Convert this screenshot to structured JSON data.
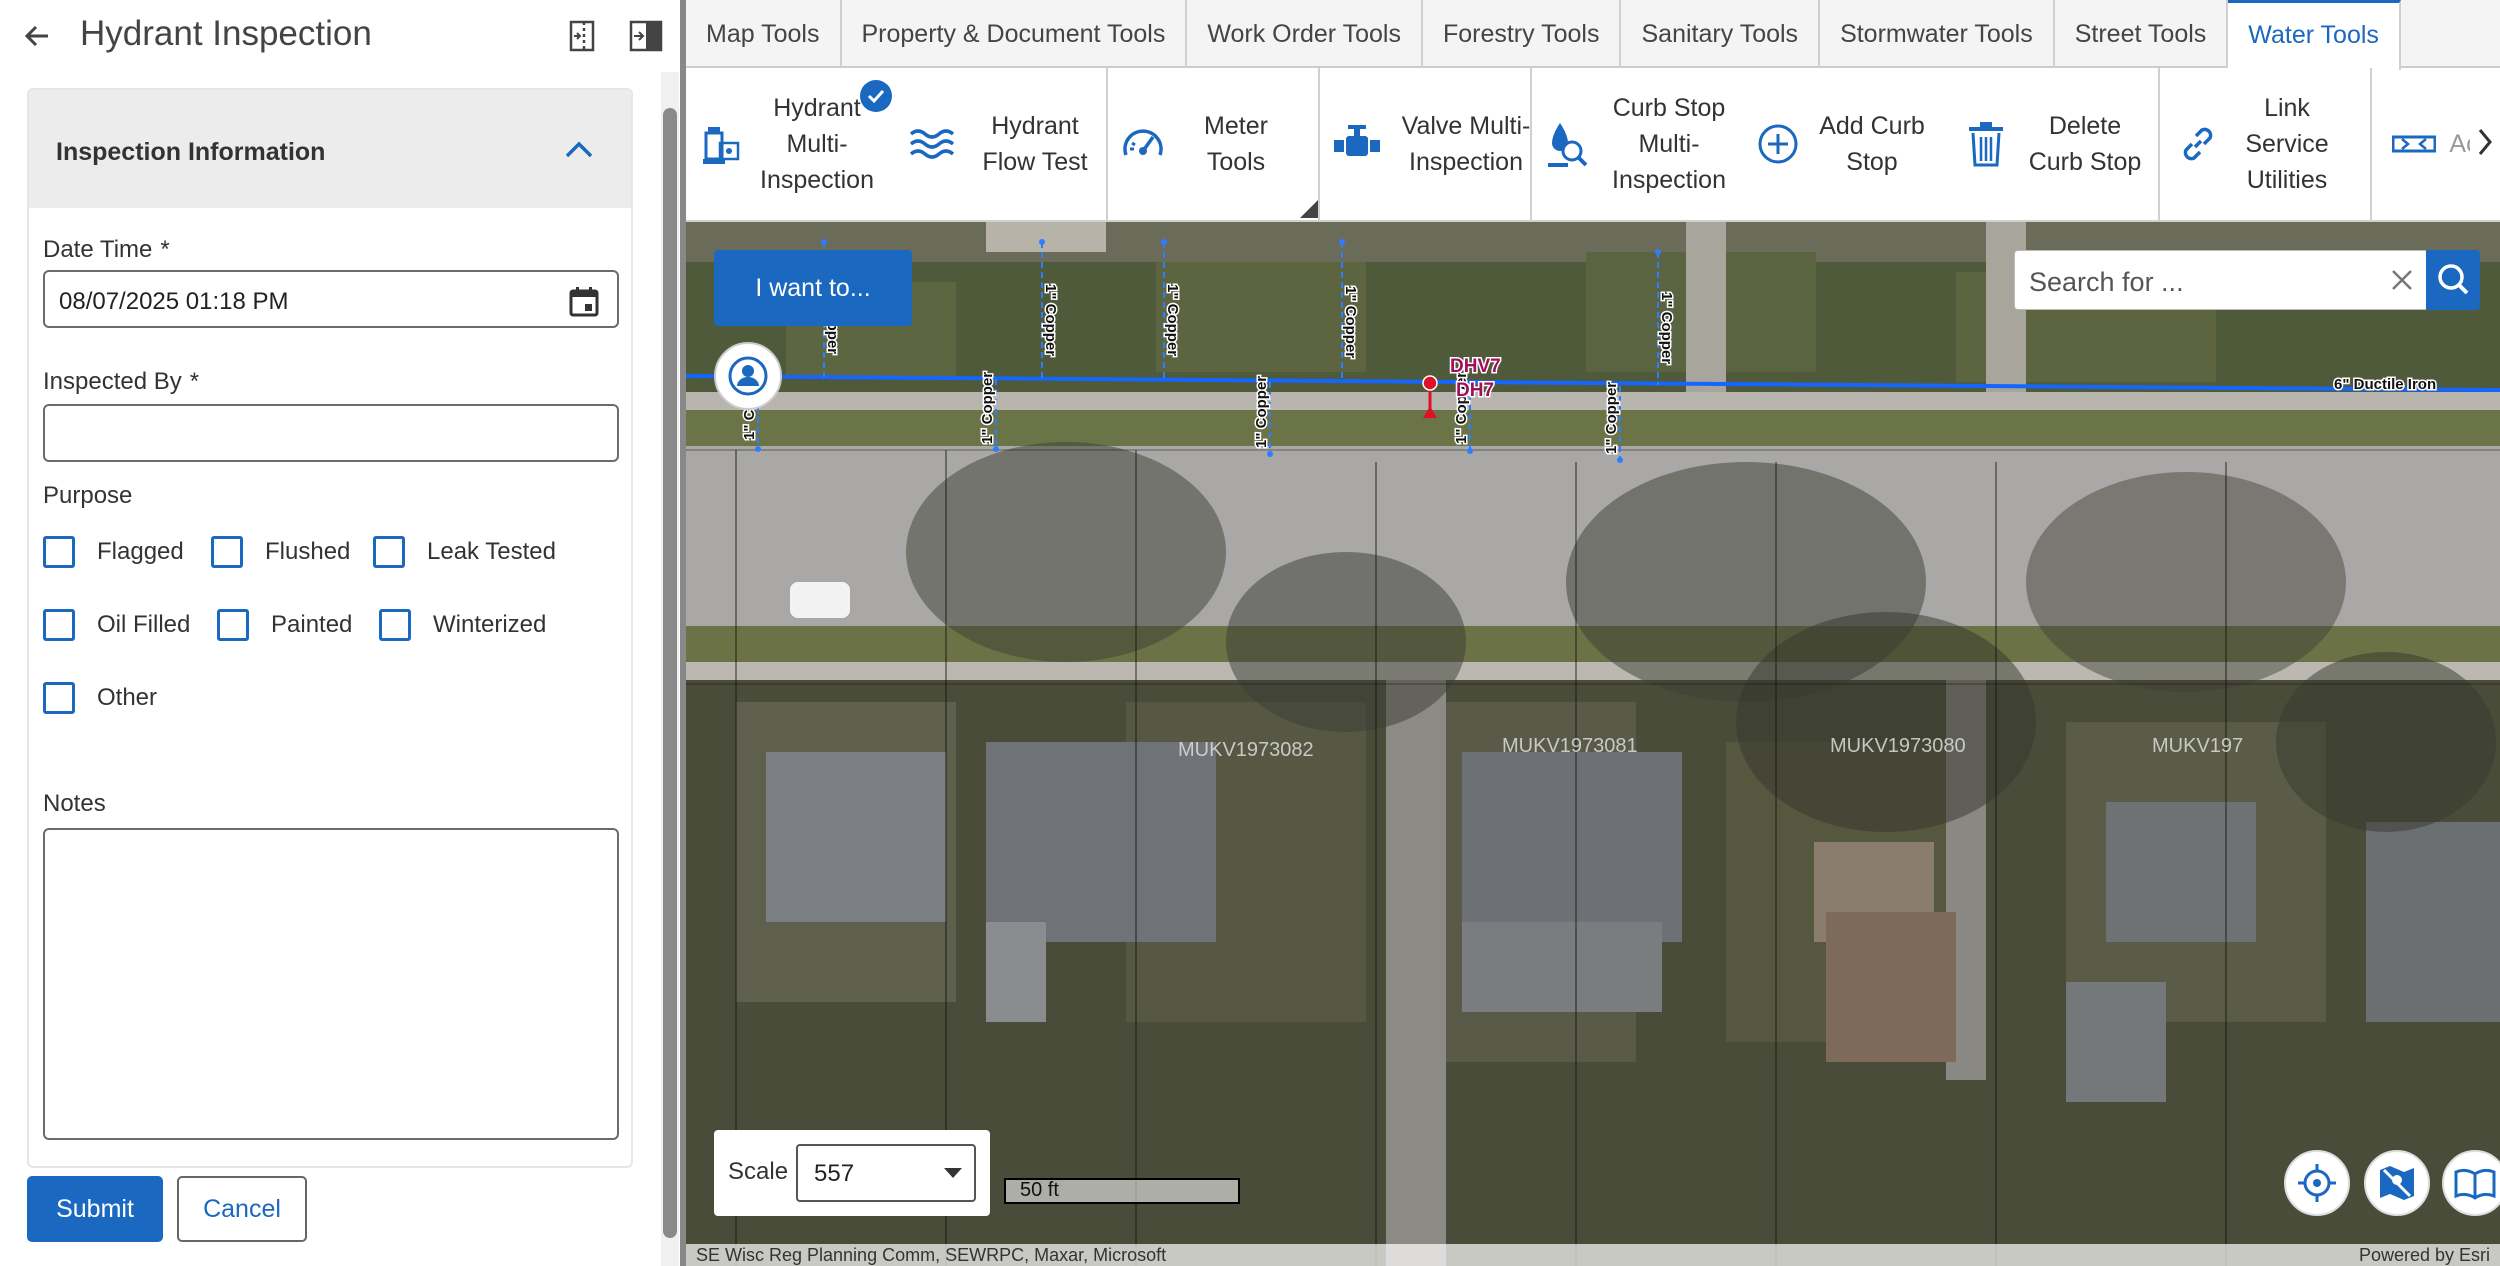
{
  "panel": {
    "title": "Hydrant Inspection",
    "section_title": "Inspection Information",
    "date_time_label": "Date Time",
    "date_time_value": "08/07/2025 01:18 PM",
    "inspected_by_label": "Inspected By",
    "inspected_by_value": "",
    "required_marker": "*",
    "purpose_label": "Purpose",
    "purpose_options": [
      "Flagged",
      "Flushed",
      "Leak Tested",
      "Oil Filled",
      "Painted",
      "Winterized",
      "Other"
    ],
    "notes_label": "Notes",
    "notes_value": "",
    "submit_label": "Submit",
    "cancel_label": "Cancel"
  },
  "tabs": [
    "Map Tools",
    "Property & Document Tools",
    "Work Order Tools",
    "Forestry Tools",
    "Sanitary Tools",
    "Stormwater Tools",
    "Street Tools",
    "Water Tools"
  ],
  "active_tab": "Water Tools",
  "ribbon": {
    "hydrant_multi": "Hydrant Multi-Inspection",
    "hydrant_flow": "Hydrant Flow Test",
    "meter_tools": "Meter Tools",
    "valve_multi": "Valve Multi-Inspection",
    "curb_stop_multi": "Curb Stop Multi-Inspection",
    "add_curb_stop": "Add Curb Stop",
    "delete_curb_stop": "Delete Curb Stop",
    "link_service": "Link Service Utilities",
    "partial_button": "Ac"
  },
  "map": {
    "i_want_to": "I want to...",
    "search_placeholder": "Search for ...",
    "scale_label": "Scale",
    "scale_value": "557",
    "scalebar_label": "50 ft",
    "service_label": "1\" Copper",
    "main_label": "6\" Ductile Iron",
    "hydrant_label": "DH7",
    "valve_label": "DHV7",
    "parcel_labels": [
      "MUKV1973082",
      "MUKV1973081",
      "MUKV1973080",
      "MUKV197"
    ],
    "attribution": "SE Wisc Reg Planning Comm, SEWRPC, Maxar, Microsoft",
    "powered_by": "Powered by Esri"
  },
  "colors": {
    "accent": "#1b68c1",
    "water_main": "#1565ff",
    "hydrant": "#e0102a",
    "label_magenta": "#a0105a"
  }
}
